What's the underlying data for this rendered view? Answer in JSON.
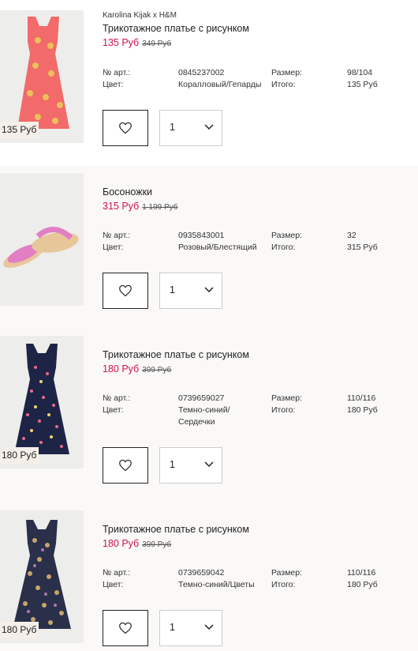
{
  "labels": {
    "article": "№ арт.:",
    "color": "Цвет:",
    "size": "Размер:",
    "total": "Итого:"
  },
  "items": [
    {
      "brand": "Karolina Kijak x H&M",
      "title": "Трикотажное платье с рисунком",
      "price_new": "135 Руб",
      "price_old": "349 Руб",
      "thumb_price": "135 Руб",
      "article": "0845237002",
      "color_line1": "Коралловый/Гепарды",
      "color_line2": "",
      "size": "98/104",
      "total": "135 Руб",
      "qty": "1",
      "image": "coral-cheetah-dress"
    },
    {
      "brand": "",
      "title": "Босоножки",
      "price_new": "315 Руб",
      "price_old": "1 199 Руб",
      "thumb_price": "",
      "article": "0935843001",
      "color_line1": "Розовый/Блестящий",
      "color_line2": "",
      "size": "32",
      "total": "315 Руб",
      "qty": "1",
      "image": "pink-glitter-sandals"
    },
    {
      "brand": "",
      "title": "Трикотажное платье с рисунком",
      "price_new": "180 Руб",
      "price_old": "399 Руб",
      "thumb_price": "180 Руб",
      "article": "0739659027",
      "color_line1": "Темно-синий/",
      "color_line2": "Сердечки",
      "size": "110/116",
      "total": "180 Руб",
      "qty": "1",
      "image": "navy-hearts-dress"
    },
    {
      "brand": "",
      "title": "Трикотажное платье с рисунком",
      "price_new": "180 Руб",
      "price_old": "399 Руб",
      "thumb_price": "180 Руб",
      "article": "0739659042",
      "color_line1": "Темно-синий/Цветы",
      "color_line2": "",
      "size": "110/116",
      "total": "180 Руб",
      "qty": "1",
      "image": "navy-floral-dress"
    }
  ],
  "colors": {
    "price_new": "#d0124f",
    "coral": "#f26a6a",
    "navy": "#1e2446",
    "sandal_pink": "#e27fc4"
  }
}
